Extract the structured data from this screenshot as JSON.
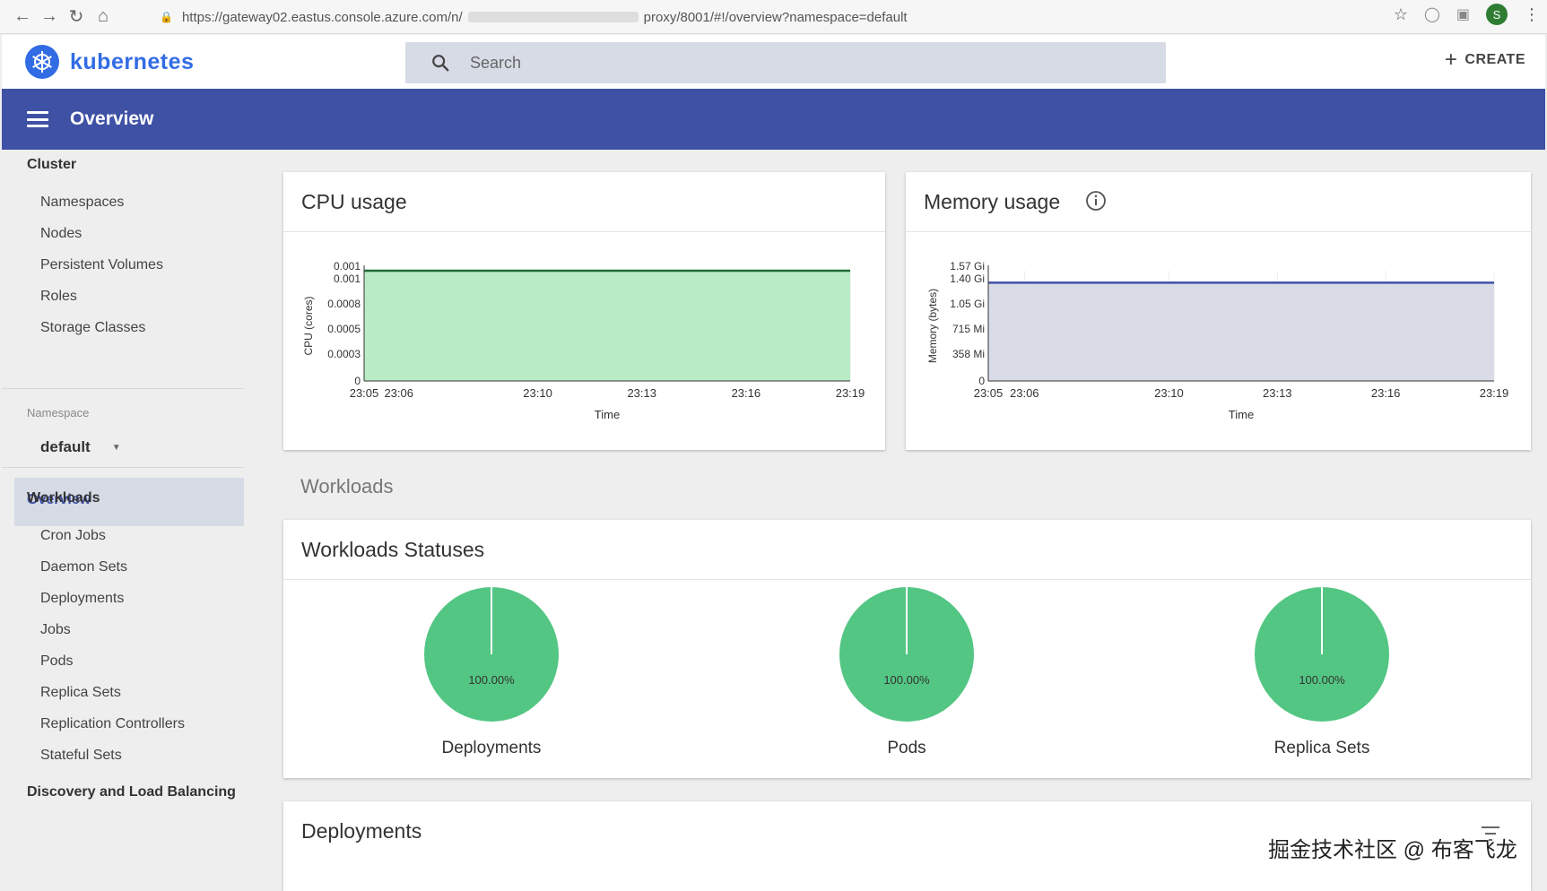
{
  "browser": {
    "url_start": "https://gateway02.eastus.console.azure.com/n/",
    "url_end": "proxy/8001/#!/overview?namespace=default",
    "profile_initial": "S"
  },
  "header": {
    "logo_text": "kubernetes",
    "search_placeholder": "Search",
    "create_label": "CREATE"
  },
  "topbar": {
    "title": "Overview"
  },
  "sidebar": {
    "cluster_label": "Cluster",
    "cluster_items": [
      "Namespaces",
      "Nodes",
      "Persistent Volumes",
      "Roles",
      "Storage Classes"
    ],
    "namespace_label": "Namespace",
    "namespace_value": "default",
    "overview_label": "Overview",
    "workloads_label": "Workloads",
    "workload_items": [
      "Cron Jobs",
      "Daemon Sets",
      "Deployments",
      "Jobs",
      "Pods",
      "Replica Sets",
      "Replication Controllers",
      "Stateful Sets"
    ],
    "discovery_label": "Discovery and Load Balancing"
  },
  "cpu_card": {
    "title": "CPU usage"
  },
  "memory_card": {
    "title": "Memory usage"
  },
  "workloads_section": "Workloads",
  "statuses_card": {
    "title": "Workloads Statuses",
    "pies": [
      {
        "label": "Deployments",
        "percent_text": "100.00%"
      },
      {
        "label": "Pods",
        "percent_text": "100.00%"
      },
      {
        "label": "Replica Sets",
        "percent_text": "100.00%"
      }
    ]
  },
  "deployments_card": {
    "title": "Deployments"
  },
  "watermark": "掘金技术社区 @ 布客飞龙",
  "colors": {
    "brand": "#326ce5",
    "topbar": "#3f51a5",
    "cpu_fill": "#b9ebc4",
    "cpu_line": "#1e6b34",
    "mem_fill": "#d9dbe6",
    "mem_line": "#3f51a5",
    "pie_green": "#53c683"
  },
  "chart_data": [
    {
      "type": "area",
      "title": "CPU usage",
      "xlabel": "Time",
      "ylabel": "CPU (cores)",
      "x": [
        "23:05",
        "23:06",
        "23:10",
        "23:13",
        "23:16",
        "23:19"
      ],
      "y_ticks": [
        "0",
        "0.0003",
        "0.0005",
        "0.0008",
        "0.001",
        "0.001"
      ],
      "series": [
        {
          "values": [
            0.001,
            0.001,
            0.001,
            0.001,
            0.001,
            0.001
          ]
        }
      ],
      "ylim": [
        0,
        0.001
      ]
    },
    {
      "type": "area",
      "title": "Memory usage",
      "xlabel": "Time",
      "ylabel": "Memory (bytes)",
      "x": [
        "23:05",
        "23:06",
        "23:10",
        "23:13",
        "23:16",
        "23:19"
      ],
      "y_ticks": [
        "0",
        "358 Mi",
        "715 Mi",
        "1.05 Gi",
        "1.40 Gi",
        "1.57 Gi"
      ],
      "series": [
        {
          "values": [
            1.4,
            1.4,
            1.4,
            1.4,
            1.4,
            1.4
          ]
        }
      ],
      "ylim": [
        0,
        1.57
      ]
    },
    {
      "type": "pie",
      "title": "Workloads Statuses",
      "pies": [
        {
          "label": "Deployments",
          "value": 100
        },
        {
          "label": "Pods",
          "value": 100
        },
        {
          "label": "Replica Sets",
          "value": 100
        }
      ]
    }
  ]
}
